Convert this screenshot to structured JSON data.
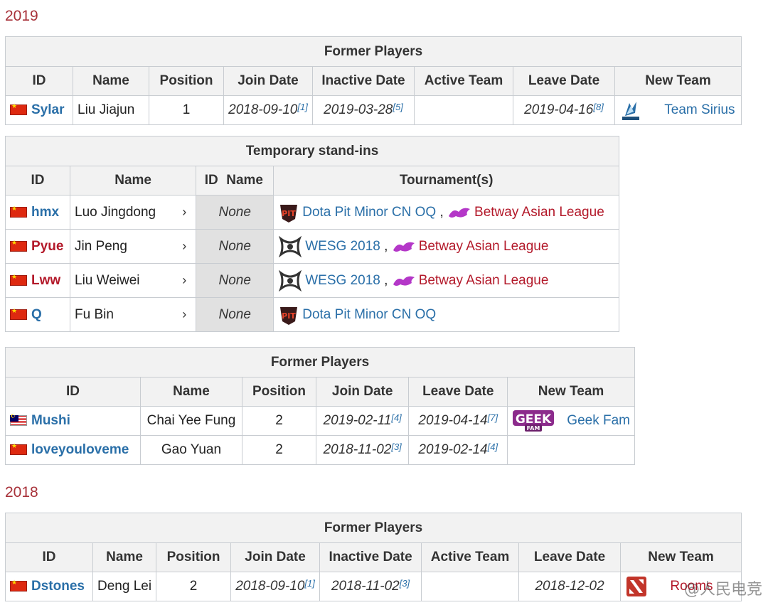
{
  "sections": [
    {
      "year": "2019"
    },
    {
      "year": "2018"
    }
  ],
  "table1": {
    "caption": "Former Players",
    "headers": [
      "ID",
      "Name",
      "Position",
      "Join Date",
      "Inactive Date",
      "Active Team",
      "Leave Date",
      "New Team"
    ],
    "rows": [
      {
        "id": "Sylar",
        "name": "Liu Jiajun",
        "position": "1",
        "join": "2018-09-10",
        "join_ref": "[1]",
        "inactive": "2019-03-28",
        "inactive_ref": "[5]",
        "active_team": "",
        "leave": "2019-04-16",
        "leave_ref": "[8]",
        "new_team": "Team Sirius",
        "new_team_logo": "sirius-logo"
      }
    ]
  },
  "table2": {
    "caption": "Temporary stand-ins",
    "headers": [
      "ID",
      "Name",
      "ID",
      "Name",
      "Tournament(s)"
    ],
    "rows": [
      {
        "id": "hmx",
        "id_color": "blue",
        "name": "Luo Jingdong",
        "sub_name": "None",
        "tournaments": [
          {
            "label": "Dota Pit Minor CN OQ",
            "logo": "dota-pit-logo",
            "color": "blue"
          },
          {
            "label": "Betway Asian League",
            "logo": "betway-logo",
            "color": "red"
          }
        ]
      },
      {
        "id": "Pyue",
        "id_color": "red",
        "name": "Jin Peng",
        "sub_name": "None",
        "tournaments": [
          {
            "label": "WESG 2018",
            "logo": "wesg-logo",
            "color": "blue"
          },
          {
            "label": "Betway Asian League",
            "logo": "betway-logo",
            "color": "red"
          }
        ]
      },
      {
        "id": "Lww",
        "id_color": "red",
        "name": "Liu Weiwei",
        "sub_name": "None",
        "tournaments": [
          {
            "label": "WESG 2018",
            "logo": "wesg-logo",
            "color": "blue"
          },
          {
            "label": "Betway Asian League",
            "logo": "betway-logo",
            "color": "red"
          }
        ]
      },
      {
        "id": "Q",
        "id_color": "blue",
        "name": "Fu Bin",
        "sub_name": "None",
        "tournaments": [
          {
            "label": "Dota Pit Minor CN OQ",
            "logo": "dota-pit-logo",
            "color": "blue"
          }
        ]
      }
    ],
    "separator": ","
  },
  "table3": {
    "caption": "Former Players",
    "headers": [
      "ID",
      "Name",
      "Position",
      "Join Date",
      "Leave Date",
      "New Team"
    ],
    "rows": [
      {
        "id": "Mushi",
        "flag": "malaysia",
        "name": "Chai Yee Fung",
        "position": "2",
        "join": "2019-02-11",
        "join_ref": "[4]",
        "leave": "2019-04-14",
        "leave_ref": "[7]",
        "new_team": "Geek Fam",
        "new_team_logo": "geek-fam-logo"
      },
      {
        "id": "loveyouloveme",
        "flag": "china",
        "name": "Gao Yuan",
        "position": "2",
        "join": "2018-11-02",
        "join_ref": "[3]",
        "leave": "2019-02-14",
        "leave_ref": "[4]",
        "new_team": ""
      }
    ]
  },
  "table4": {
    "caption": "Former Players",
    "headers": [
      "ID",
      "Name",
      "Position",
      "Join Date",
      "Inactive Date",
      "Active Team",
      "Leave Date",
      "New Team"
    ],
    "rows": [
      {
        "id": "Dstones",
        "name": "Deng Lei",
        "position": "2",
        "join": "2018-09-10",
        "join_ref": "[1]",
        "inactive": "2018-11-02",
        "inactive_ref": "[3]",
        "active_team": "",
        "leave": "2018-12-02",
        "new_team": "Rooms",
        "new_team_logo": "dota2-logo"
      }
    ]
  },
  "watermark": "@人民电竞",
  "colors": {
    "link_blue": "#2a6fa8",
    "link_red": "#b3192a",
    "year_red": "#a8323a",
    "header_bg": "#f2f2f2",
    "none_bg": "#e1e1e1",
    "border": "#c8ccd1"
  }
}
